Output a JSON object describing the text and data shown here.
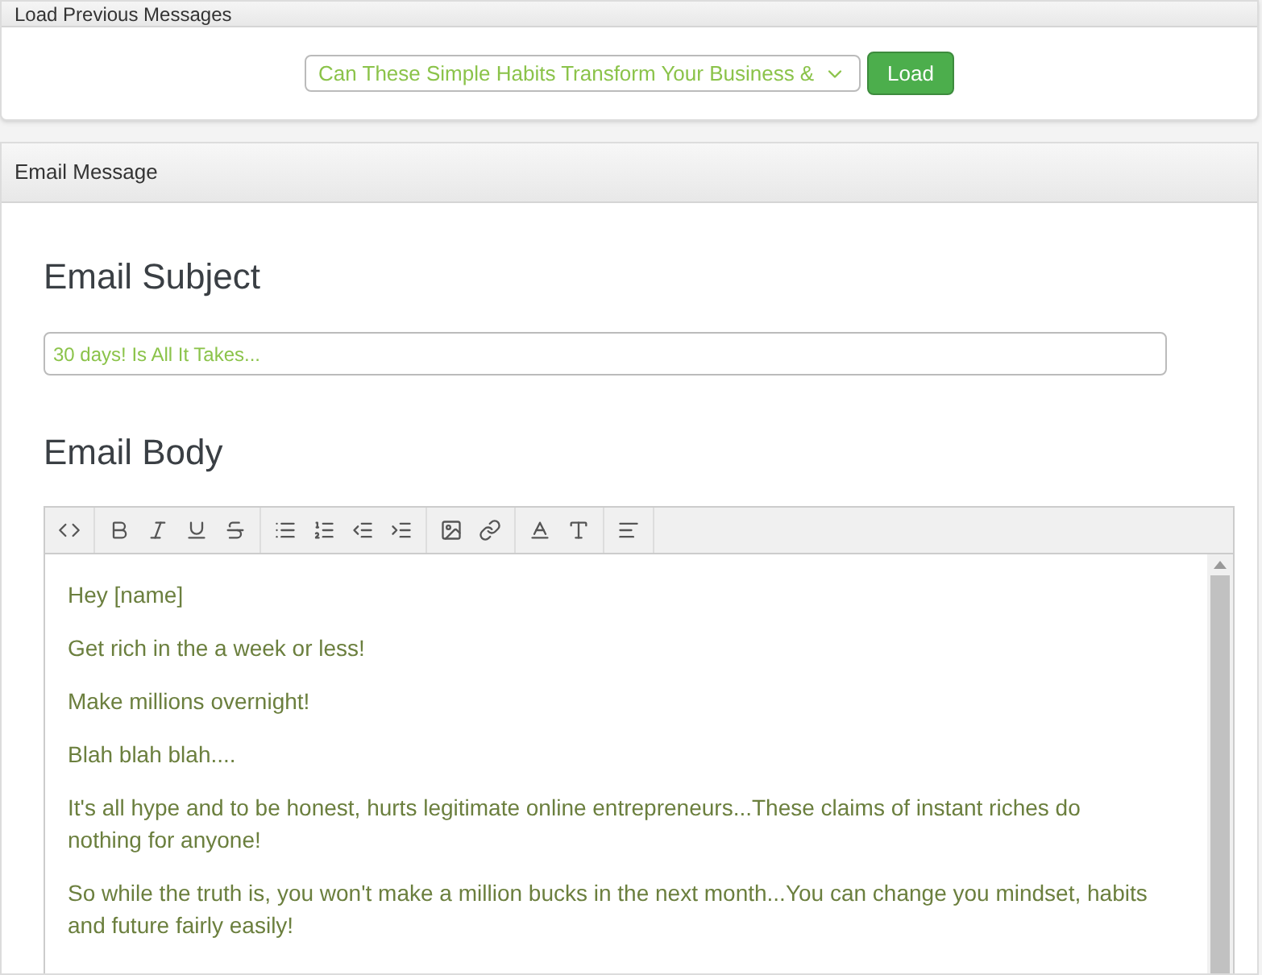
{
  "load_previous": {
    "title": "Load Previous Messages",
    "select_value": "Can These Simple Habits Transform Your Business &",
    "button": "Load"
  },
  "email_message": {
    "title": "Email Message",
    "subject_heading": "Email Subject",
    "subject_value": "30 days! Is All It Takes...",
    "body_heading": "Email Body",
    "body_paragraphs": [
      "Hey [name]",
      "Get rich in the a week or less!",
      "Make millions overnight!",
      "Blah blah blah....",
      "It's all hype and to be honest, hurts legitimate online entrepreneurs...These claims of instant riches do nothing for anyone!",
      "So while the truth is, you won't make a million bucks in the next month...You can change you mindset, habits and future fairly easily!"
    ]
  }
}
